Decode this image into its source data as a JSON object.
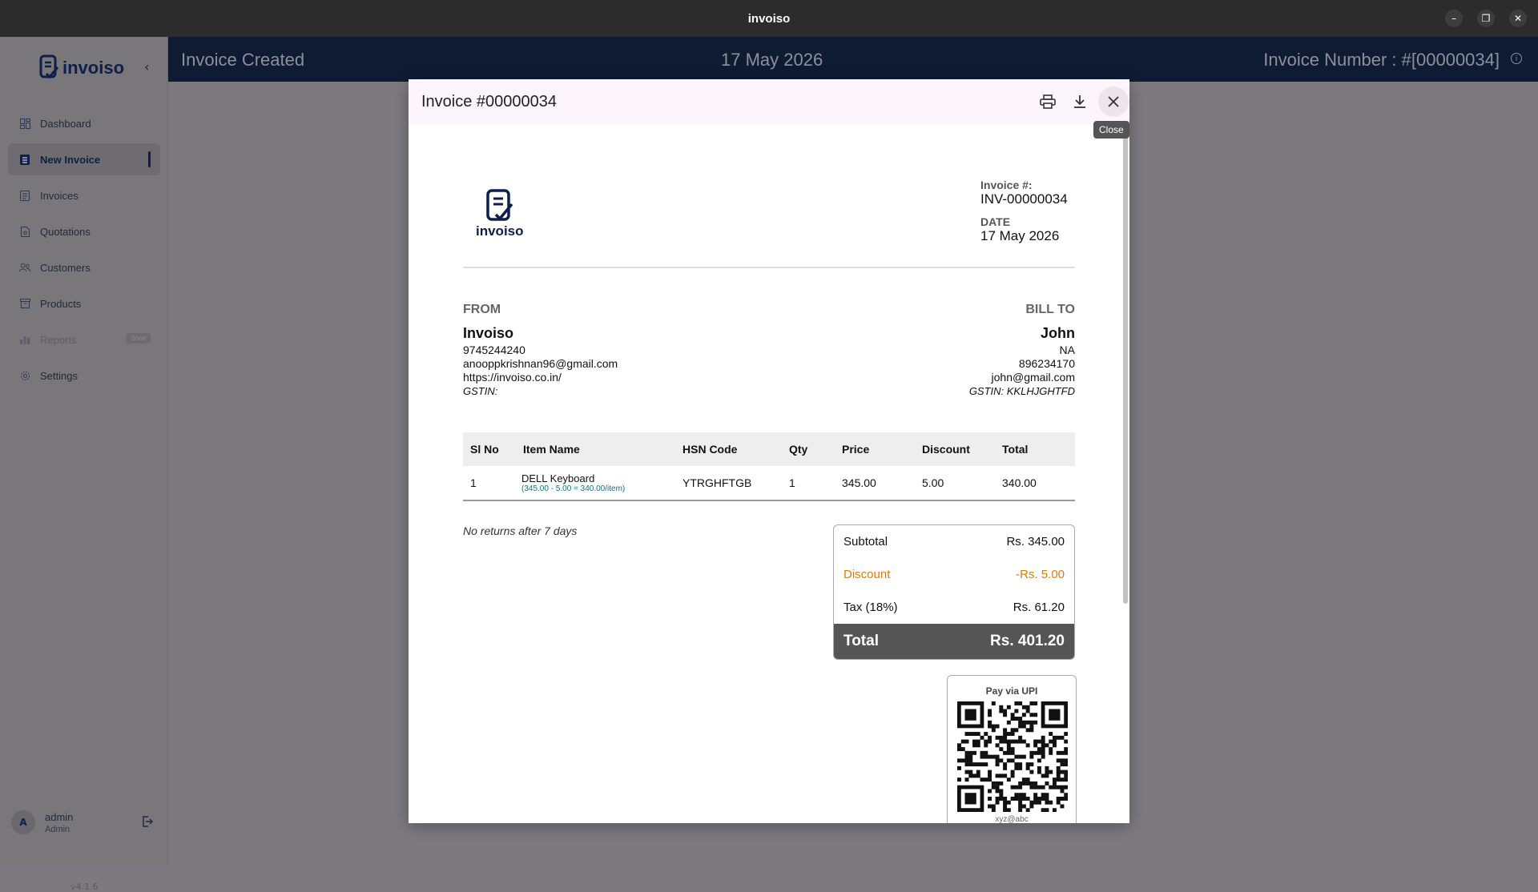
{
  "window": {
    "title": "invoiso"
  },
  "sidebar": {
    "brand": "invoiso",
    "items": [
      {
        "label": "Dashboard",
        "icon": "dashboard-icon"
      },
      {
        "label": "New Invoice",
        "icon": "invoice-icon",
        "active": true
      },
      {
        "label": "Invoices",
        "icon": "invoices-icon"
      },
      {
        "label": "Quotations",
        "icon": "quotation-icon"
      },
      {
        "label": "Customers",
        "icon": "customers-icon"
      },
      {
        "label": "Products",
        "icon": "products-icon"
      },
      {
        "label": "Reports",
        "icon": "reports-icon",
        "badge": "Soon",
        "disabled": true
      },
      {
        "label": "Settings",
        "icon": "settings-icon"
      }
    ],
    "user": {
      "initial": "A",
      "name": "admin",
      "role": "Admin"
    },
    "version": "v4.1.6"
  },
  "header": {
    "status": "Invoice Created",
    "date": "17 May 2026",
    "invoice_number": "Invoice Number : #[00000034]"
  },
  "modal": {
    "title": "Invoice #00000034",
    "close_tooltip": "Close"
  },
  "invoice": {
    "logo_text": "invoiso",
    "number_label": "Invoice #:",
    "number": "INV-00000034",
    "date_label": "DATE",
    "date": "17 May 2026",
    "from": {
      "label": "FROM",
      "name": "Invoiso",
      "phone": "9745244240",
      "email": "anooppkrishnan96@gmail.com",
      "website": "https://invoiso.co.in/",
      "gstin": "GSTIN:"
    },
    "bill_to": {
      "label": "BILL TO",
      "name": "John",
      "address": "NA",
      "phone": "896234170",
      "email": "john@gmail.com",
      "gstin": "GSTIN: KKLHJGHTFD"
    },
    "columns": [
      "Sl No",
      "Item Name",
      "HSN Code",
      "Qty",
      "Price",
      "Discount",
      "Total"
    ],
    "items": [
      {
        "sl": "1",
        "name": "DELL Keyboard",
        "detail": "(345.00 - 5.00 = 340.00/item)",
        "hsn": "YTRGHFTGB",
        "qty": "1",
        "price": "345.00",
        "discount": "5.00",
        "total": "340.00"
      }
    ],
    "terms": "No returns after 7 days",
    "totals": {
      "subtotal_label": "Subtotal",
      "subtotal": "Rs. 345.00",
      "discount_label": "Discount",
      "discount": "-Rs. 5.00",
      "tax_label": "Tax (18%)",
      "tax": "Rs. 61.20",
      "total_label": "Total",
      "total": "Rs. 401.20"
    },
    "upi": {
      "title": "Pay via UPI",
      "id": "xyz@abc"
    }
  },
  "colors": {
    "navy": "#0d1f4a",
    "discount": "#e07b00",
    "total_bg": "#555555"
  }
}
